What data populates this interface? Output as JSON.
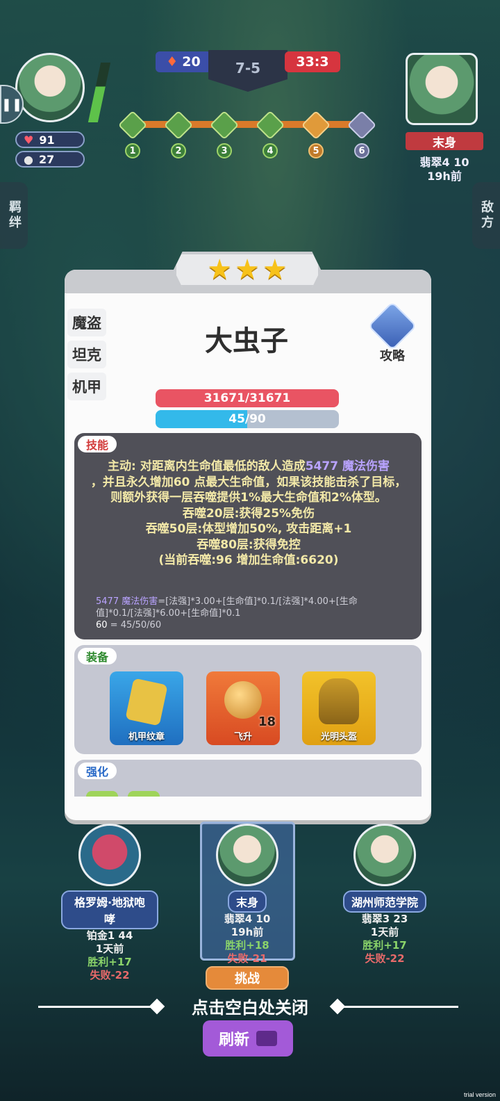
{
  "top": {
    "left_score": "20",
    "center_round": "7-5",
    "right_timer": "33:3",
    "trophy_numbers": [
      "1",
      "2",
      "3",
      "4",
      "5",
      "6"
    ]
  },
  "player": {
    "hp": "91",
    "coins": "27"
  },
  "enemy_preview": {
    "name": "末身",
    "rank": "翡翠4 10",
    "time": "19h前"
  },
  "side_tabs": {
    "left": "羁绊",
    "right": "敌方"
  },
  "unit": {
    "stars": 3,
    "name": "大虫子",
    "classes": [
      "魔盗",
      "坦克",
      "机甲"
    ],
    "guide_label": "攻略",
    "hp_text": "31671/31671",
    "mana_text": "45/90",
    "mana_fraction": 0.5
  },
  "skill": {
    "tag": "技能",
    "line1a": "主动: 对距离内生命值最低的敌人造成",
    "line1b": "5477 魔法伤害",
    "line2": "，并且永久增加60 点最大生命值，如果该技能击杀了目标，则额外获得一层吞噬提供1%最大生命值和2%体型。",
    "line3": "吞噬20层:获得25%免伤",
    "line4": "吞噬50层:体型增加50%, 攻击距离+1",
    "line5": "吞噬80层:获得免控",
    "line6": "(当前吞噬:96 增加生命值:6620)",
    "formula_a": "5477 魔法伤害",
    "formula_b": "=[法强]*3.00+[生命值]*0.1/[法强]*4.00+[生命值]*0.1/[法强]*6.00+[生命值]*0.1",
    "formula_c": "60",
    "formula_d": " = 45/50/60"
  },
  "equipment": {
    "tag": "装备",
    "items": [
      {
        "name": "机甲纹章",
        "badge": ""
      },
      {
        "name": "飞升",
        "badge": "18"
      },
      {
        "name": "光明头盔",
        "badge": ""
      }
    ]
  },
  "enhance": {
    "tag": "强化"
  },
  "opponents": [
    {
      "name": "格罗姆·地狱咆哮",
      "rank": "铂金1 44",
      "time": "1天前",
      "win": "胜利+17",
      "lose": "失败-22"
    },
    {
      "name": "末身",
      "rank": "翡翠4 10",
      "time": "19h前",
      "win": "胜利+18",
      "lose": "失败-21"
    },
    {
      "name": "湖州师范学院",
      "rank": "翡翠3 23",
      "time": "1天前",
      "win": "胜利+17",
      "lose": "失败-22"
    }
  ],
  "challenge_label": "挑战",
  "close_hint": "点击空白处关闭",
  "refresh_label": "刷新",
  "watermark": "trial version"
}
